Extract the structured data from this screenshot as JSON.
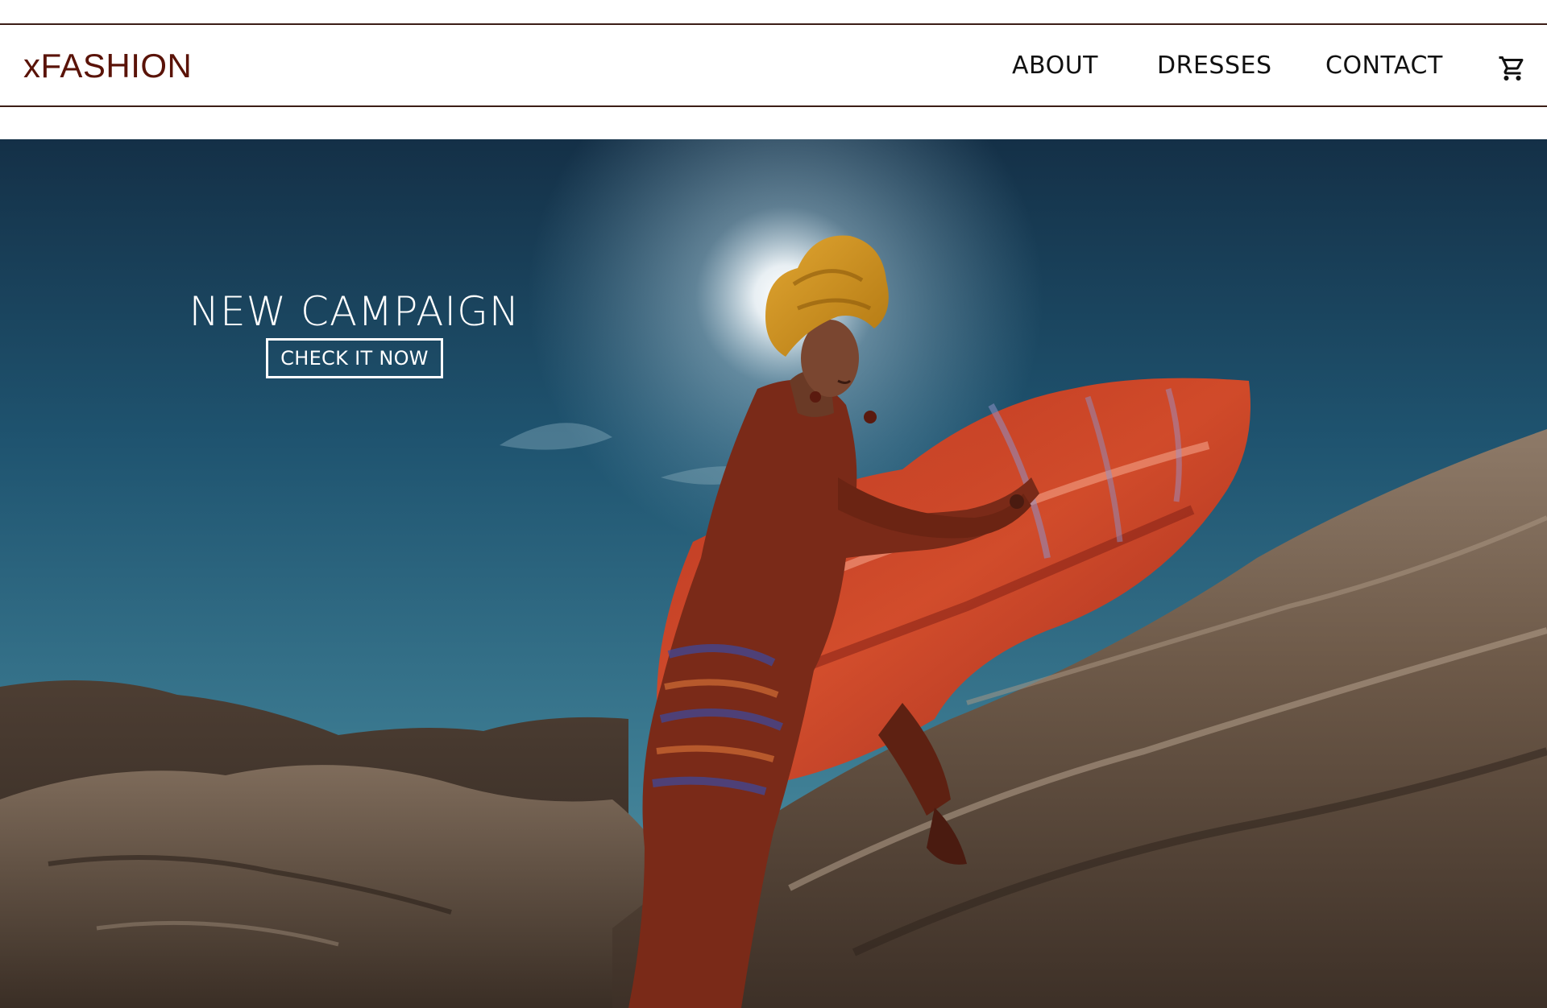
{
  "site": {
    "logo": "xFASHION",
    "brand_color": "#5a1308"
  },
  "nav": {
    "items": [
      {
        "label": "ABOUT"
      },
      {
        "label": "DRESSES"
      },
      {
        "label": "CONTACT"
      }
    ],
    "cart_icon": "shopping-cart-icon"
  },
  "hero": {
    "title": "NEW CAMPAIGN",
    "cta_label": "CHECK IT NOW",
    "image_subject": "model in a flowing red patterned dress and golden head wrap posing on desert rocks under a blue sky"
  }
}
